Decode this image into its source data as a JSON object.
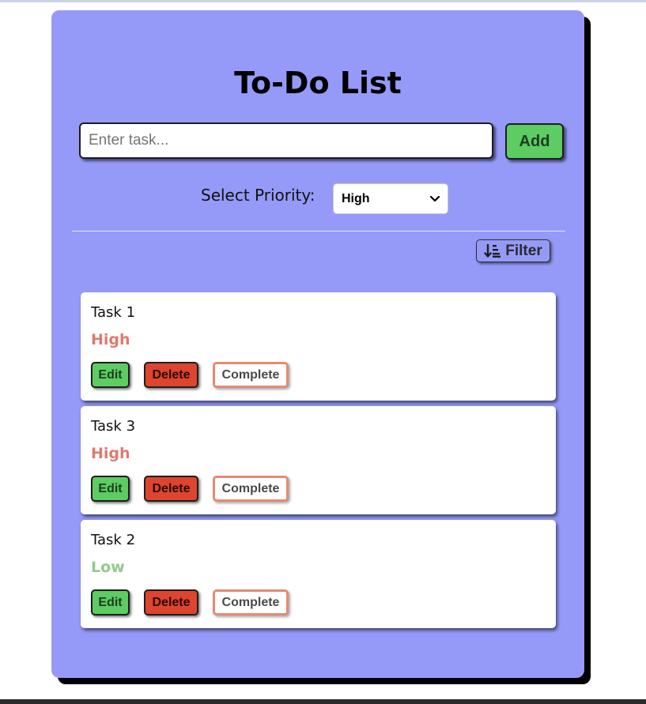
{
  "app": {
    "title": "To-Do List"
  },
  "input": {
    "placeholder": "Enter task...",
    "value": ""
  },
  "add_button": {
    "label": "Add"
  },
  "priority": {
    "label": "Select Priority:",
    "selected": "High"
  },
  "filter": {
    "label": "Filter",
    "icon": "sort-descending-icon"
  },
  "tasks": [
    {
      "name": "Task 1",
      "priority": "High",
      "priority_color": "#dd7a72"
    },
    {
      "name": "Task 3",
      "priority": "High",
      "priority_color": "#dd7a72"
    },
    {
      "name": "Task 2",
      "priority": "Low",
      "priority_color": "#93c98b"
    }
  ],
  "task_buttons": {
    "edit": "Edit",
    "delete": "Delete",
    "complete": "Complete"
  },
  "colors": {
    "card_background": "#959af9",
    "add_button": "#5ccc63",
    "edit_button": "#5ccc63",
    "delete_button": "#dd452e",
    "complete_border": "#e58a74"
  }
}
